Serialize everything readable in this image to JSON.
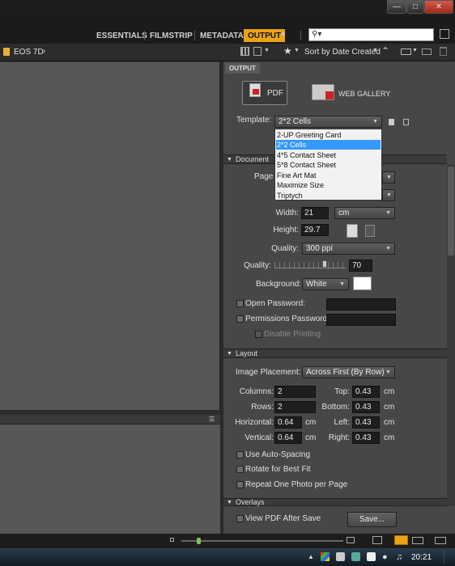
{
  "menubar": {
    "workspaces": [
      "ESSENTIALS",
      "FILMSTRIP",
      "METADATA",
      "OUTPUT"
    ],
    "active_workspace": "OUTPUT",
    "search_placeholder": ""
  },
  "pathbar": {
    "folder": "EOS 7D",
    "sort_label": "Sort by Date Created"
  },
  "output_panel": {
    "tab": "OUTPUT",
    "pdf_label": "PDF",
    "web_gallery_label": "WEB GALLERY",
    "template_label": "Template:",
    "template_value": "2*2 Cells",
    "template_options": [
      "2-UP Greeting Card",
      "2*2 Cells",
      "4*5 Contact Sheet",
      "5*8 Contact Sheet",
      "Fine Art Mat",
      "Maximize Size",
      "Triptych"
    ],
    "template_selected_index": 1
  },
  "document": {
    "header": "Document",
    "page_label": "Page",
    "width_label": "Width:",
    "width_value": "21",
    "unit_value": "cm",
    "height_label": "Height:",
    "height_value": "29.7",
    "quality_label": "Quality:",
    "quality_value": "300 ppi",
    "quality2_label": "Quality:",
    "quality2_value": "70",
    "quality2_slider_fraction": 0.7,
    "background_label": "Background:",
    "background_value": "White",
    "background_color": "#ffffff",
    "open_password_label": "Open Password:",
    "permissions_password_label": "Permissions Password:",
    "disable_printing_label": "Disable Printing"
  },
  "layout": {
    "header": "Layout",
    "image_placement_label": "Image Placement:",
    "image_placement_value": "Across First (By Row)",
    "columns_label": "Columns:",
    "columns_value": "2",
    "rows_label": "Rows:",
    "rows_value": "2",
    "horizontal_label": "Horizontal:",
    "horizontal_value": "0.64",
    "vertical_label": "Vertical:",
    "vertical_value": "0.64",
    "top_label": "Top:",
    "top_value": "0.43",
    "bottom_label": "Bottom:",
    "bottom_value": "0.43",
    "left_label": "Left:",
    "left_value": "0.43",
    "right_label": "Right:",
    "right_value": "0.43",
    "unit": "cm",
    "auto_spacing_label": "Use Auto-Spacing",
    "rotate_label": "Rotate for Best Fit",
    "repeat_label": "Repeat One Photo per Page"
  },
  "overlays": {
    "header": "Overlays",
    "view_pdf_label": "View PDF After Save",
    "save_label": "Save..."
  },
  "taskbar": {
    "time": "20:21"
  },
  "colors": {
    "accent": "#e8a317",
    "selection": "#3399ff"
  }
}
